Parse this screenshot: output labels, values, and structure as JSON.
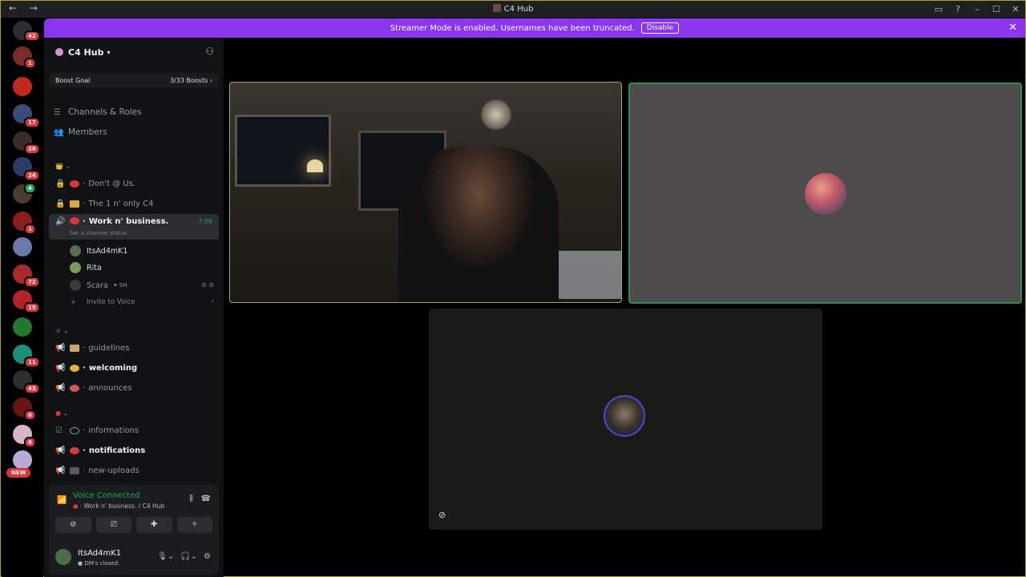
{
  "window": {
    "title": "C4 Hub",
    "nav_back": "←",
    "nav_forward": "→"
  },
  "banner": {
    "text": "Streamer Mode is enabled. Usernames have been truncated.",
    "button": "Disable"
  },
  "rail": {
    "badges": [
      "42",
      "1",
      "17",
      "26",
      "24",
      "4",
      "1",
      "72",
      "15",
      "11",
      "43",
      "6",
      "8"
    ],
    "new_label": "NEW"
  },
  "server": {
    "name": "C4 Hub"
  },
  "boost": {
    "label": "Boost Goal",
    "progress": "3/33 Boosts"
  },
  "links": {
    "channels_roles": "Channels & Roles",
    "members": "Members"
  },
  "channels": {
    "dont_at": "Don't @ Us.",
    "only_c4": "The 1 n' only C4",
    "work": "Work n' business.",
    "work_time": "7:09",
    "set_status": "Set a channel status",
    "voice_users": [
      "ItsAd4mK1",
      "Rita",
      "Scara"
    ],
    "scara_tag": "SH",
    "invite": "Invite to Voice",
    "guidelines": "guidelines",
    "welcoming": "welcoming",
    "announces": "announces",
    "informations": "informations",
    "notifications": "notifications",
    "new_uploads": "new-uploads"
  },
  "voice_panel": {
    "status": "Voice Connected",
    "channel": "Work n' business. / C4 Hub"
  },
  "user": {
    "name": "ItsAd4mK1",
    "status": "DM's closed."
  },
  "colors": {
    "accent": "#8c35f0",
    "connected": "#23a55a",
    "danger": "#da373c"
  }
}
